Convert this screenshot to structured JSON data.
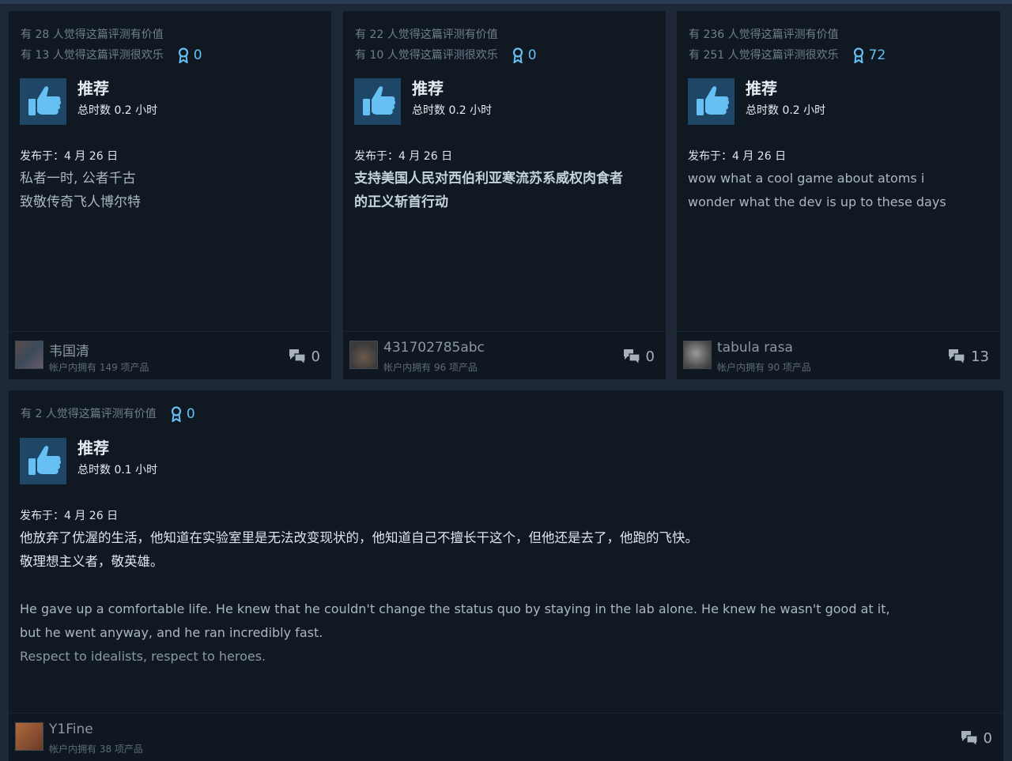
{
  "reviews": [
    {
      "helpful_line": "有 28 人觉得这篇评测有价值",
      "funny_line": "有 13 人觉得这篇评测很欢乐",
      "awards": "0",
      "recommendation": "推荐",
      "hours": "总时数 0.2 小时",
      "posted": "发布于：4 月 26 日",
      "content_lines": [
        "私者一时, 公者千古",
        "致敬传奇飞人博尔特"
      ],
      "username": "韦国清",
      "products_owned": "帐户内拥有 149 项产品",
      "comment_count": "0"
    },
    {
      "helpful_line": "有 22 人觉得这篇评测有价值",
      "funny_line": "有 10 人觉得这篇评测很欢乐",
      "awards": "0",
      "recommendation": "推荐",
      "hours": "总时数 0.2 小时",
      "posted": "发布于：4 月 26 日",
      "content_lines": [
        "支持美国人民对西伯利亚寒流苏系威权肉食者",
        "的正义斩首行动"
      ],
      "username": "431702785abc",
      "products_owned": "帐户内拥有 96 项产品",
      "comment_count": "0"
    },
    {
      "helpful_line": "有 236 人觉得这篇评测有价值",
      "funny_line": "有 251 人觉得这篇评测很欢乐",
      "awards": "72",
      "recommendation": "推荐",
      "hours": "总时数 0.2 小时",
      "posted": "发布于：4 月 26 日",
      "content_lines": [
        "wow what a cool game about atoms i",
        "wonder what the dev is up to these days"
      ],
      "username": "tabula rasa",
      "products_owned": "帐户内拥有 90 项产品",
      "comment_count": "13"
    },
    {
      "helpful_line": "有 2 人觉得这篇评测有价值",
      "awards": "0",
      "recommendation": "推荐",
      "hours": "总时数 0.1 小时",
      "posted": "发布于：4 月 26 日",
      "content_lines": [
        "他放弃了优渥的生活，他知道在实验室里是无法改变现状的，他知道自己不擅长干这个，但他还是去了，他跑的飞快。",
        "敬理想主义者，敬英雄。",
        "He gave up a comfortable life. He knew that he couldn't change the status quo by staying in the lab alone. He knew he wasn't good at it,",
        "but he went anyway, and he ran incredibly fast.",
        "Respect to idealists, respect to heroes."
      ],
      "username": "Y1Fine",
      "products_owned": "帐户内拥有 38 项产品",
      "comment_count": "0"
    }
  ],
  "icons": {
    "award": "award-ribbon-icon",
    "thumb": "thumbs-up-icon",
    "comments": "comment-bubbles-icon"
  },
  "colors": {
    "page_bg": "#1e2837",
    "card_bg": "#101822",
    "accent": "#66c0f4",
    "thumb_bg": "#1e4767"
  }
}
